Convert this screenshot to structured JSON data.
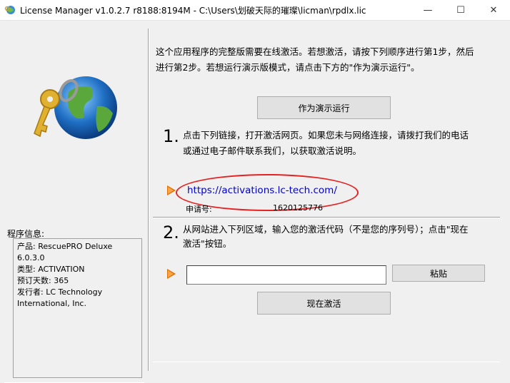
{
  "window": {
    "title": "License Manager v1.0.2.7 r8188:8194M - C:\\Users\\划破天际的璀璨\\licman\\rpdlx.lic",
    "minimize_glyph": "—",
    "maximize_glyph": "☐",
    "close_glyph": "✕"
  },
  "left_panel": {
    "info_label": "程序信息:",
    "info_lines": [
      "产品:   RescuePRO Deluxe",
      "6.0.3.0",
      "类型:   ACTIVATION",
      "预订天数:   365",
      "发行者:   LC Technology",
      "International, Inc."
    ]
  },
  "main": {
    "intro_line1": "这个应用程序的完整版需要在线激活。若想激活，请按下列顺序进行第1步，然后",
    "intro_line2": "进行第2步。若想运行演示版模式，请点击下方的\"作为演示运行\"。",
    "demo_button": "作为演示运行",
    "step1": {
      "number": "1.",
      "text_line1": "点击下列链接，打开激活网页。如果您未与网络连接，请拨打我们的电话",
      "text_line2": "或通过电子邮件联系我们，以获取激活说明。",
      "link": "https://activations.lc-tech.com/",
      "request_label": "申请号:",
      "request_value": "1620125776"
    },
    "step2": {
      "number": "2.",
      "text_line1": "从网站进入下列区域，输入您的激活代码（不是您的序列号）；点击\"现在",
      "text_line2": "激活\"按钮。",
      "code_value": "",
      "paste_button": "粘贴",
      "activate_button": "现在激活"
    }
  },
  "colors": {
    "accent_arrow": "#e07000",
    "link": "#0000cc",
    "highlight_ellipse": "#e52222"
  }
}
